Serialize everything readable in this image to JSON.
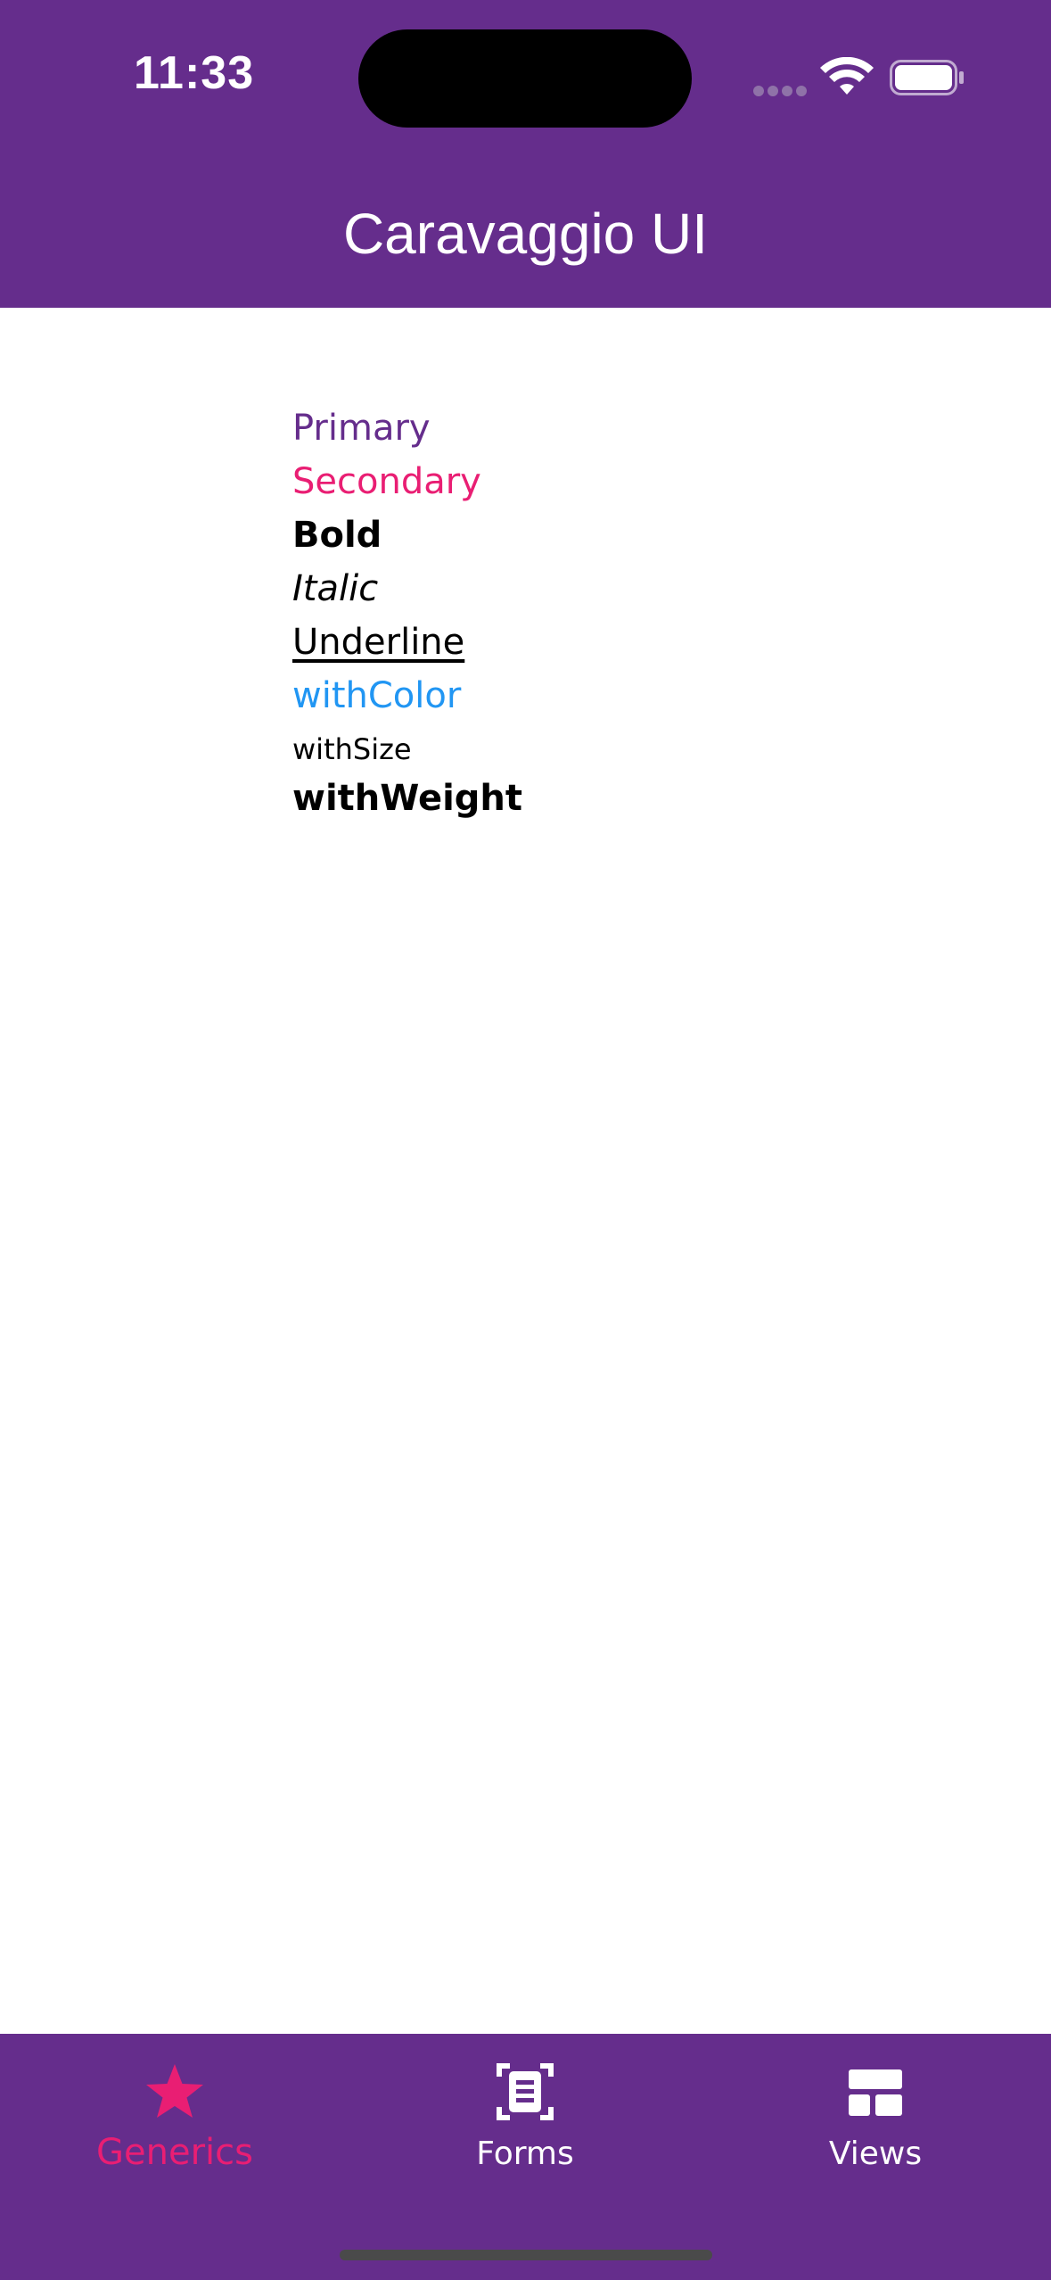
{
  "status_bar": {
    "time": "11:33"
  },
  "app_bar": {
    "title": "Caravaggio UI"
  },
  "content": {
    "items": [
      "Primary",
      "Secondary",
      "Bold",
      "Italic",
      "Underline",
      "withColor",
      "withSize",
      "withWeight"
    ]
  },
  "bottom_nav": {
    "items": [
      {
        "label": "Generics",
        "icon": "star-icon",
        "active": true
      },
      {
        "label": "Forms",
        "icon": "form-icon",
        "active": false
      },
      {
        "label": "Views",
        "icon": "views-icon",
        "active": false
      }
    ]
  },
  "colors": {
    "primary": "#652d8c",
    "secondary": "#e91e73",
    "accent_blue": "#2196f3",
    "background": "#ffffff"
  }
}
